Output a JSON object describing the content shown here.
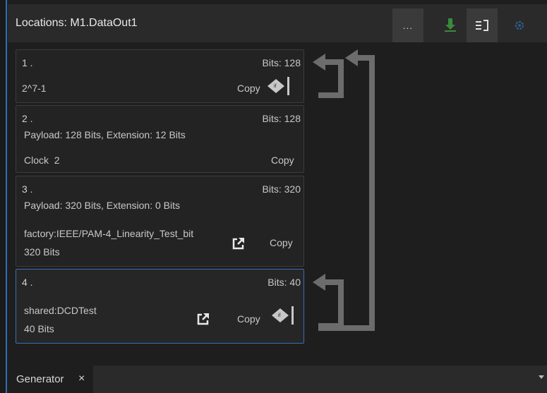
{
  "header": {
    "title": "Locations: M1.DataOut1",
    "more_label": "...",
    "icons": [
      "download-icon",
      "panel-toggle-icon",
      "settings-icon"
    ]
  },
  "cards": [
    {
      "index": "1 .",
      "bits": "Bits: 128",
      "value": "2^7-1",
      "copy": "Copy"
    },
    {
      "index": "2 .",
      "bits": "Bits: 128",
      "payload": "Payload: 128 Bits, Extension: 12 Bits",
      "value": "Clock  2",
      "copy": "Copy"
    },
    {
      "index": "3 .",
      "bits": "Bits: 320",
      "payload": "Payload: 320 Bits, Extension: 0 Bits",
      "value": "factory:IEEE/PAM-4_Linearity_Test_bit",
      "size": "320 Bits",
      "copy": "Copy"
    },
    {
      "index": "4 .",
      "bits": "Bits: 40",
      "value": "shared:DCDTest",
      "size": "40 Bits",
      "copy": "Copy"
    }
  ],
  "footer": {
    "tab_label": "Generator",
    "close_symbol": "×"
  },
  "colors": {
    "accent": "#3b6fb6",
    "arrow": "#6c6c6c",
    "download_icon": "#3a8a3a"
  }
}
